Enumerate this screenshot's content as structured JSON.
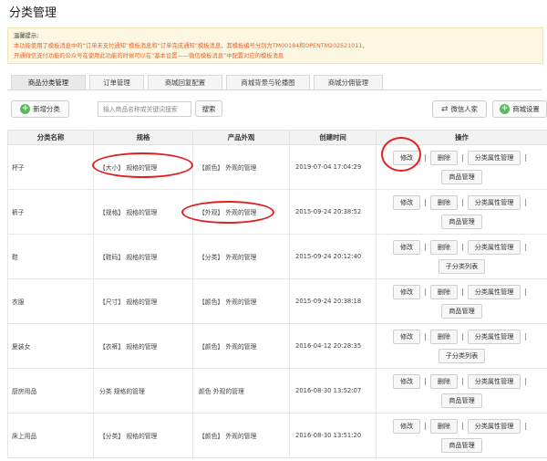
{
  "page_title": "分类管理",
  "notice": {
    "heading": "温馨提示:",
    "line1": "本功能使用了模板消息中的“订单未支付通知”模板消息和“订单完成通知”模板消息，其模板编号分别为TM00184和OPENTM202521011，",
    "line2": "开通微信支付功能的公众号在使用此功能的时候可以在”基本设置——微信模板消息“中配置对应的模板消息"
  },
  "tabs": [
    "商品分类管理",
    "订单管理",
    "商城回复配置",
    "商城背景与轮播图",
    "商城分佣管理"
  ],
  "toolbar": {
    "add_label": "新增分类",
    "search_placeholder": "输入商品名称或关键词搜索",
    "search_label": "搜索",
    "wechat_label": "微信人家",
    "settings_label": "商城设置"
  },
  "table": {
    "headers": [
      "分类名称",
      "规格",
      "产品外观",
      "创建时间",
      "操作"
    ],
    "rows": [
      {
        "name": "杯子",
        "spec": "【大小】 规格的管理",
        "look": "【颜色】 外观的管理",
        "time": "2019-07-04 17:04:29",
        "extra": "商品管理"
      },
      {
        "name": "裤子",
        "spec": "【规格】 规格的管理",
        "look": "【外观】 外观的管理",
        "time": "2015-09-24 20:38:52",
        "extra": "商品管理"
      },
      {
        "name": "鞋",
        "spec": "【鞋码】 规格的管理",
        "look": "【分类】 外观的管理",
        "time": "2015-09-24 20:12:40",
        "extra": "子分类列表"
      },
      {
        "name": "衣服",
        "spec": "【尺寸】 规格的管理",
        "look": "【颜色】 外观的管理",
        "time": "2015-09-24 20:38:18",
        "extra": "商品管理"
      },
      {
        "name": "夏装女",
        "spec": "【衣裤】 规格的管理",
        "look": "【颜色】 外观的管理",
        "time": "2016-04-12 20:28:35",
        "extra": "子分类列表"
      },
      {
        "name": "厨房用品",
        "spec": "分类 规格的管理",
        "look": "颜色 外观的管理",
        "time": "2016-08-30 13:52:07",
        "extra": "商品管理"
      },
      {
        "name": "床上用品",
        "spec": "【分类】 规格的管理",
        "look": "【颜色】 外观的管理",
        "time": "2016-08-30 13:51:20",
        "extra": "商品管理"
      }
    ],
    "ops": {
      "edit": "修改",
      "delete": "删除",
      "attr": "分类属性管理",
      "sep": "|"
    }
  },
  "annotation_color": "#e02020",
  "accent_green": "#5cb85c"
}
